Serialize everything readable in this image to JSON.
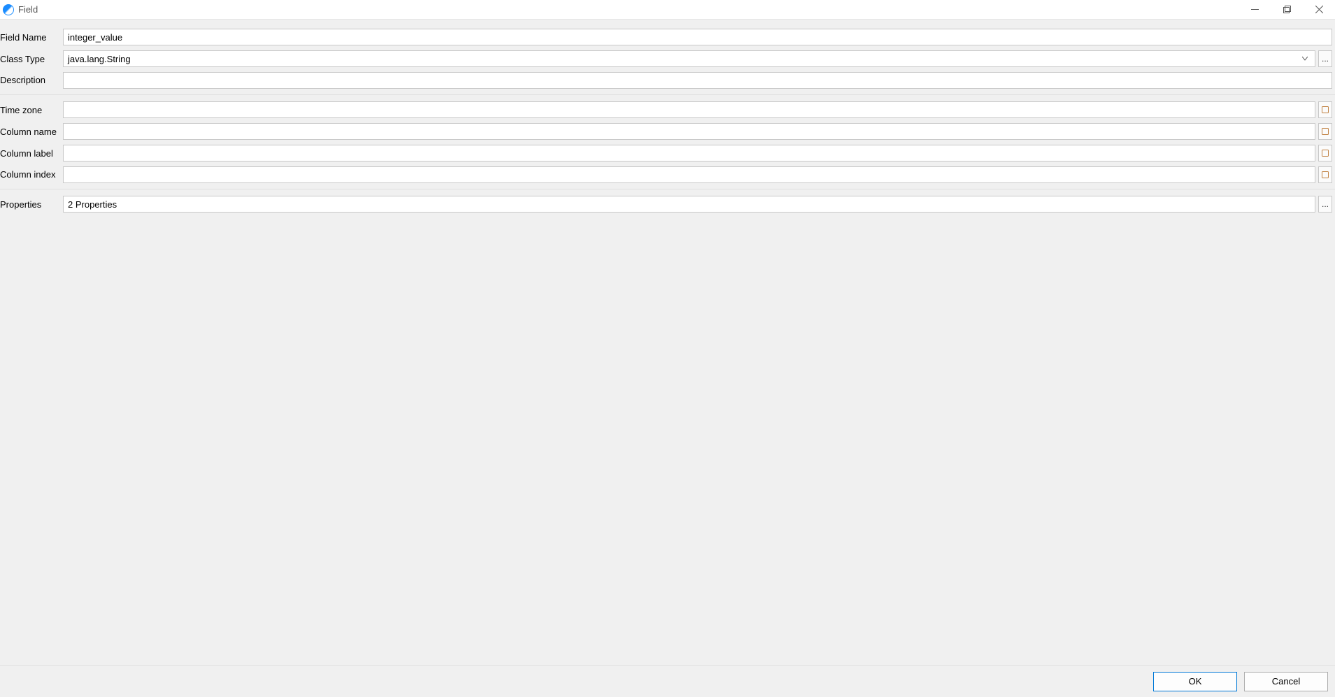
{
  "window": {
    "title": "Field"
  },
  "labels": {
    "field_name": "Field Name",
    "class_type": "Class Type",
    "description": "Description",
    "time_zone": "Time zone",
    "column_name": "Column name",
    "column_label": "Column label",
    "column_index": "Column index",
    "properties": "Properties"
  },
  "values": {
    "field_name": "integer_value",
    "class_type": "java.lang.String",
    "description": "",
    "time_zone": "",
    "column_name": "",
    "column_label": "",
    "column_index": "",
    "properties": "2 Properties"
  },
  "buttons": {
    "ok": "OK",
    "cancel": "Cancel",
    "browse": "..."
  }
}
